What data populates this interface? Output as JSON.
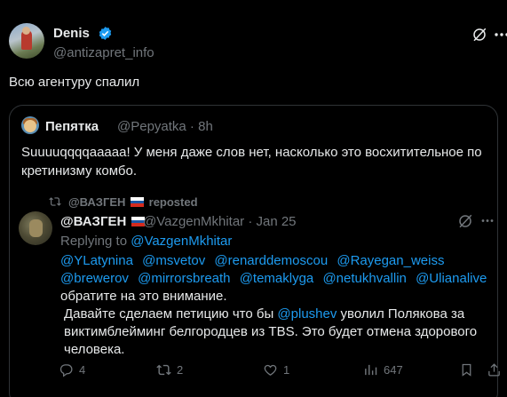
{
  "post": {
    "author_name": "Denis",
    "author_handle": "@antizapret_info",
    "text": "Всю агентуру спалил"
  },
  "quote": {
    "author_name": "Пепятка",
    "author_handle": "@Pepyatka · 8h",
    "text": "Suuuuqqqqaaaaa! У меня даже слов нет, насколько это восхитительное по кретинизму комбо."
  },
  "repost": {
    "reposter_prefix": "@ВАЗГЕН",
    "reposted_label": "reposted"
  },
  "reply": {
    "author_name": "@ВАЗГЕН",
    "meta": "@VazgenMkhitar · Jan 25",
    "replying_prefix": "Replying to",
    "replying_handle": "@VazgenMkhitar",
    "mentions": [
      "@YLatynina",
      "@msvetov",
      "@renarddemoscou",
      "@Rayegan_weiss",
      "@brewerov",
      "@mirrorsbreath",
      "@temaklyga",
      "@netukhvallin",
      "@Ulianalive"
    ],
    "mentions_tail": "обратите на это внимание.",
    "para2_start": "Давайте сделаем петицию что бы",
    "para2_mention": "@plushev",
    "para2_end": "уволил Полякова за виктимблейминг белгородцев из TBS. Это будет отмена здорового человека."
  },
  "actions": {
    "replies": "4",
    "reposts": "2",
    "likes": "1",
    "views": "647"
  },
  "colors": {
    "background": "#000000",
    "text": "#e7e9ea",
    "muted": "#71767b",
    "link": "#1d9bf0",
    "border": "#2f3336"
  }
}
